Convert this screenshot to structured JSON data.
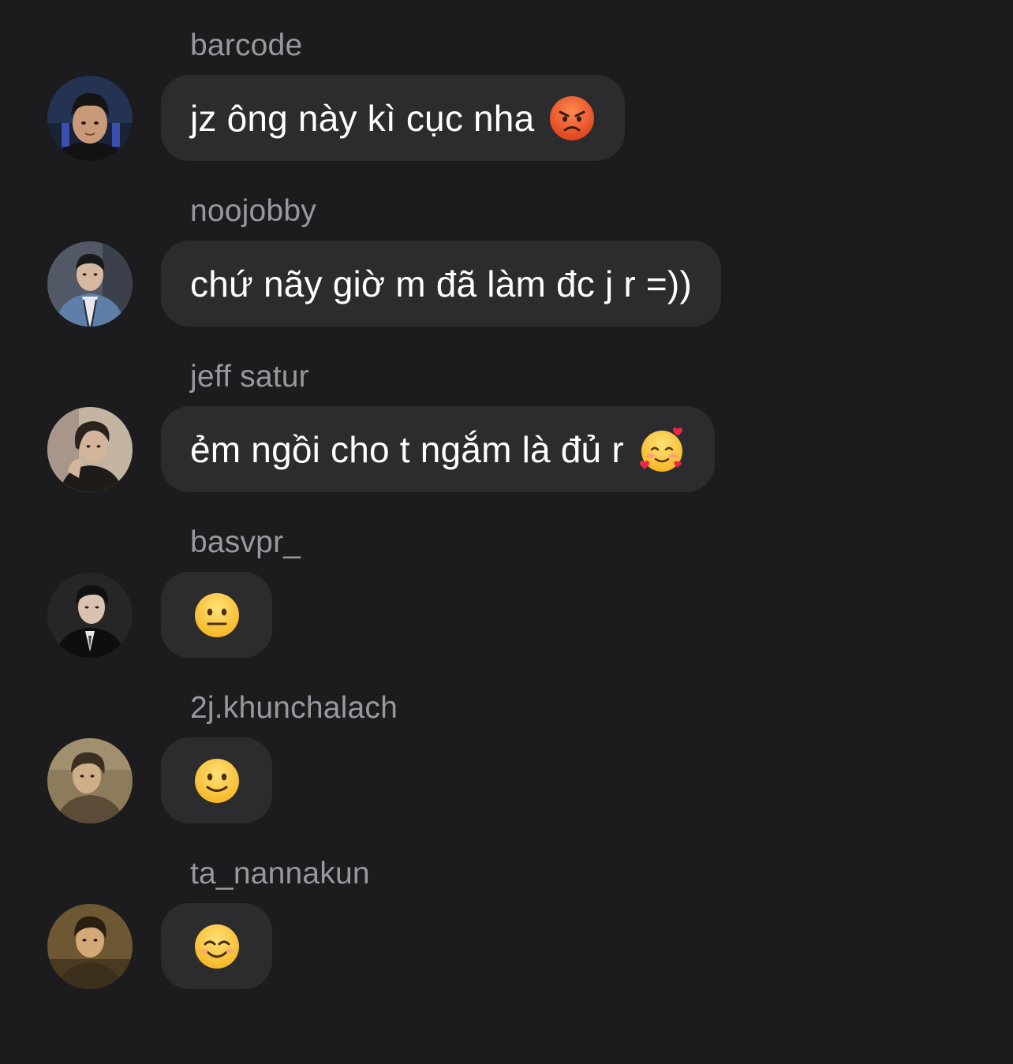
{
  "messages": [
    {
      "sender": "barcode",
      "text": "jz ông này kì cục nha",
      "emoji": "angry-face-icon",
      "avatar": {
        "bg": "#2a3550",
        "skin": "#c99a7a",
        "hair": "#151515",
        "shirt": "#1a1a1a"
      }
    },
    {
      "sender": "noojobby",
      "text": "chứ nãy giờ m đã làm đc j r =))",
      "emoji": "",
      "avatar": {
        "bg": "#4a5060",
        "skin": "#d6b8a0",
        "hair": "#1a1a1a",
        "shirt": "#5f7fa8"
      }
    },
    {
      "sender": "jeff satur",
      "text": "ẻm ngồi cho t ngắm là đủ r",
      "emoji": "smiling-face-with-hearts-icon",
      "avatar": {
        "bg": "#b9a895",
        "skin": "#d4b49a",
        "hair": "#2a221c",
        "shirt": "#1e1b18"
      }
    },
    {
      "sender": "basvpr_",
      "text": "",
      "emoji": "neutral-face-icon",
      "avatar": {
        "bg": "#1f1f1f",
        "skin": "#d9c2b0",
        "hair": "#111111",
        "shirt": "#0e0e0e"
      }
    },
    {
      "sender": "2j.khunchalach",
      "text": "",
      "emoji": "slightly-smiling-face-icon",
      "avatar": {
        "bg": "#8a7a5a",
        "skin": "#cfae8a",
        "hair": "#3a2f20",
        "shirt": "#5a4c36"
      }
    },
    {
      "sender": "ta_nannakun",
      "text": "",
      "emoji": "smiling-face-with-smiling-eyes-icon",
      "avatar": {
        "bg": "#6b5632",
        "skin": "#d3a978",
        "hair": "#2b1f12",
        "shirt": "#4a3a22"
      }
    }
  ]
}
